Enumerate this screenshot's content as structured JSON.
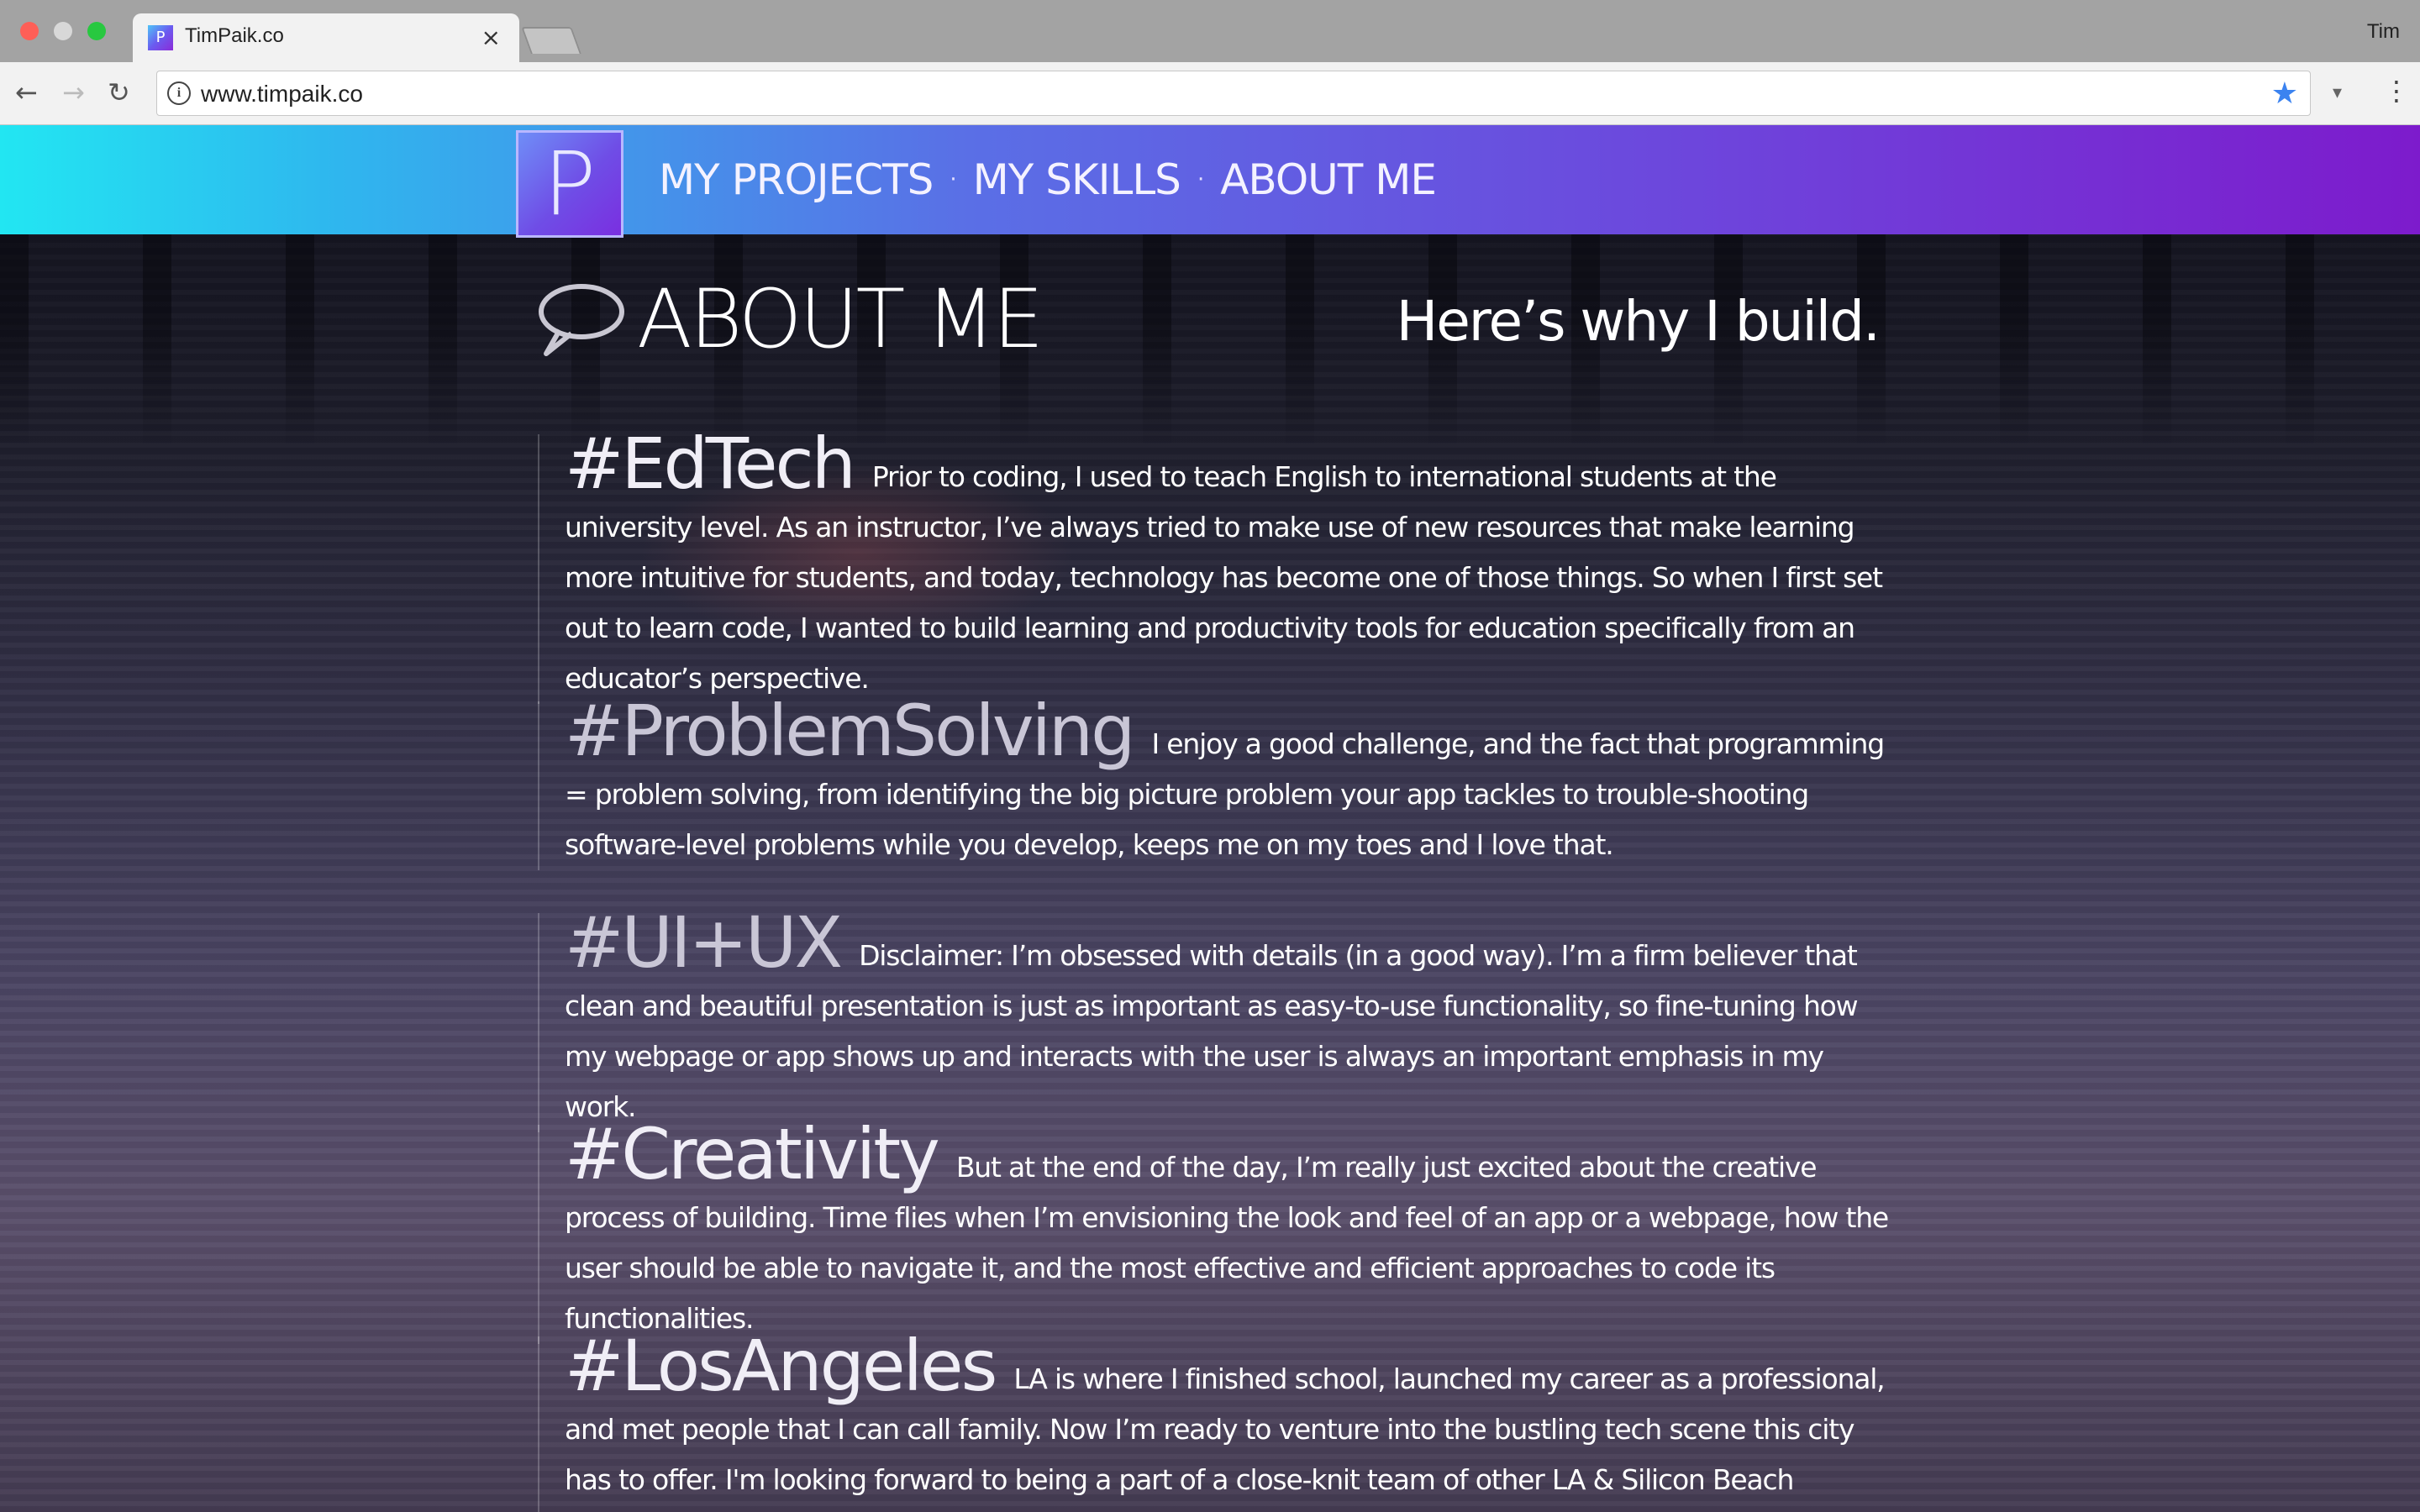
{
  "browser": {
    "tab_title": "TimPaik.co",
    "tab_favicon_letter": "P",
    "tab_close": "×",
    "profile_name": "Tim",
    "url": "www.timpaik.co",
    "back": "←",
    "forward": "→",
    "reload": "↻",
    "info": "i",
    "star": "★",
    "ext_caret": "▾",
    "menu": "⋮"
  },
  "site": {
    "logo_letter": "P",
    "nav": [
      {
        "label": "MY PROJECTS"
      },
      {
        "label": "MY SKILLS"
      },
      {
        "label": "ABOUT ME"
      }
    ],
    "nav_separator": "·",
    "gradient_colors": [
      "#22e6f2",
      "#5a6fe6",
      "#7d1bcc"
    ]
  },
  "about": {
    "title": "ABOUT ME",
    "tagline": "Here’s why I build.",
    "sections": [
      {
        "tag": "#EdTech",
        "text": "Prior to coding, I used to teach English to international students at the university level. As an instructor, I’ve always tried to make use of new resources that make learning more intuitive for students, and today, technology has become one of those things. So when I first set out to learn code, I wanted to build learning and productivity tools for education specifically from an educator’s perspective."
      },
      {
        "tag": "#ProblemSolving",
        "text": "I enjoy a good challenge, and the fact that programming = problem solving, from identifying the big picture problem your app tackles to trouble-shooting software-level problems while you develop, keeps me on my toes and I love that."
      },
      {
        "tag": "#UI+UX",
        "text": "Disclaimer: I’m obsessed with details (in a good way). I’m a firm believer that clean and beautiful presentation is just as important as easy-to-use functionality, so fine-tuning how my webpage or app shows up and interacts with the user is always an important emphasis in my work."
      },
      {
        "tag": "#Creativity",
        "text": "But at the end of the day, I’m really just excited about the creative process of building. Time flies when I’m envisioning the look and feel of an app or a webpage, how the user should be able to navigate it, and the most effective and efficient approaches to code its functionalities."
      },
      {
        "tag": "#LosAngeles",
        "text": "LA is where I finished school, launched my career as a professional, and met people that I can call family. Now I’m ready to venture into the bustling tech scene this city has to offer. I'm looking forward to being a part of a close-knit team of other LA & Silicon Beach developers."
      }
    ]
  }
}
